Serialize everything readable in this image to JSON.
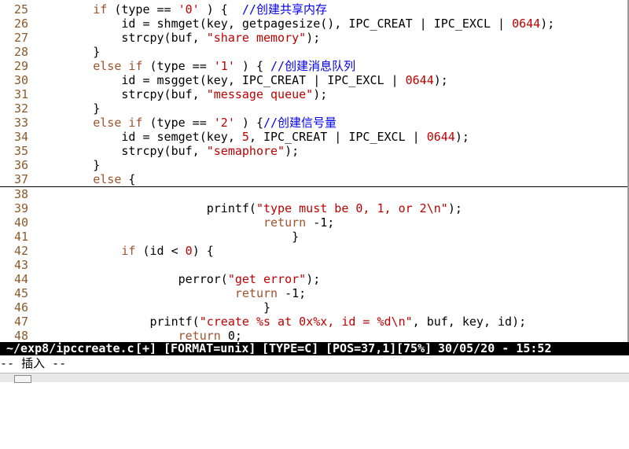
{
  "colors": {
    "keyword": "#a0522d",
    "string": "#c00000",
    "comment": "#0000ee",
    "line_number": "#8b5a2b",
    "status_bg": "#000000",
    "status_fg": "#ffffff"
  },
  "lines": [
    {
      "n": "25",
      "indent": "        ",
      "tokens": [
        [
          "kw",
          "if"
        ],
        [
          "",
          "",
          " "
        ],
        [
          "",
          "("
        ],
        [
          "",
          "type "
        ],
        [
          "",
          "== "
        ],
        [
          "str",
          "'0'"
        ],
        [
          "",
          " )  {  "
        ],
        [
          "cmt",
          "//创建共享内存"
        ]
      ]
    },
    {
      "n": "26",
      "indent": "",
      "tokens": []
    },
    {
      "n": "27",
      "indent": "",
      "tokens": []
    }
  ],
  "code": [
    {
      "n": "25",
      "segs": [
        [
          "",
          "        "
        ],
        [
          "kw",
          "if"
        ],
        [
          "",
          " (type == "
        ],
        [
          "str",
          "'0'"
        ],
        [
          "",
          " ) {  "
        ],
        [
          "cmt",
          "//创建共享内存"
        ]
      ]
    },
    {
      "n": "26",
      "segs": [
        [
          "",
          "            id = shmget(key, getpagesize(), IPC_CREAT | IPC_EXCL | "
        ],
        [
          "num",
          "0644"
        ],
        [
          "",
          ");"
        ]
      ]
    },
    {
      "n": "27",
      "segs": [
        [
          "",
          "            strcpy(buf, "
        ],
        [
          "str",
          "\"share memory\""
        ],
        [
          "",
          ");"
        ]
      ]
    },
    {
      "n": "28",
      "segs": [
        [
          "",
          "        }"
        ]
      ]
    },
    {
      "n": "29",
      "segs": [
        [
          "",
          "        "
        ],
        [
          "kw",
          "else if"
        ],
        [
          "",
          " (type == "
        ],
        [
          "str",
          "'1'"
        ],
        [
          "",
          " ) { "
        ],
        [
          "cmt",
          "//创建消息队列"
        ]
      ]
    },
    {
      "n": "30",
      "segs": [
        [
          "",
          "            id = msgget(key, IPC_CREAT | IPC_EXCL | "
        ],
        [
          "num",
          "0644"
        ],
        [
          "",
          ");"
        ]
      ]
    },
    {
      "n": "31",
      "segs": [
        [
          "",
          "            strcpy(buf, "
        ],
        [
          "str",
          "\"message queue\""
        ],
        [
          "",
          ");"
        ]
      ]
    },
    {
      "n": "32",
      "segs": [
        [
          "",
          "        }"
        ]
      ]
    },
    {
      "n": "33",
      "segs": [
        [
          "",
          "        "
        ],
        [
          "kw",
          "else if"
        ],
        [
          "",
          " (type == "
        ],
        [
          "str",
          "'2'"
        ],
        [
          "",
          " ) {"
        ],
        [
          "cmt",
          "//创建信号量"
        ]
      ]
    },
    {
      "n": "34",
      "segs": [
        [
          "",
          "            id = semget(key, "
        ],
        [
          "num",
          "5"
        ],
        [
          "",
          ", IPC_CREAT | IPC_EXCL | "
        ],
        [
          "num",
          "0644"
        ],
        [
          "",
          ");"
        ]
      ]
    },
    {
      "n": "35",
      "segs": [
        [
          "",
          "            strcpy(buf, "
        ],
        [
          "str",
          "\"semaphore\""
        ],
        [
          "",
          ");"
        ]
      ]
    },
    {
      "n": "36",
      "segs": [
        [
          "",
          "        }"
        ]
      ]
    },
    {
      "n": "37",
      "segs": [
        [
          "",
          "        "
        ],
        [
          "kw",
          "else"
        ],
        [
          "",
          " {"
        ]
      ],
      "cursor": true
    },
    {
      "n": "38",
      "segs": []
    },
    {
      "n": "39",
      "segs": [
        [
          "",
          "                        printf("
        ],
        [
          "str",
          "\"type must be 0, 1, or 2\\n\""
        ],
        [
          "",
          ");"
        ]
      ]
    },
    {
      "n": "40",
      "segs": [
        [
          "",
          "                                "
        ],
        [
          "kw",
          "return"
        ],
        [
          "",
          " -1;"
        ]
      ]
    },
    {
      "n": "41",
      "segs": [
        [
          "",
          "                                    }"
        ]
      ]
    },
    {
      "n": "42",
      "segs": [
        [
          "",
          "            "
        ],
        [
          "kw",
          "if"
        ],
        [
          "",
          " (id < "
        ],
        [
          "num",
          "0"
        ],
        [
          "",
          ") {"
        ]
      ]
    },
    {
      "n": "43",
      "segs": []
    },
    {
      "n": "44",
      "segs": [
        [
          "",
          "                    perror("
        ],
        [
          "str",
          "\"get error\""
        ],
        [
          "",
          ");"
        ]
      ]
    },
    {
      "n": "45",
      "segs": [
        [
          "",
          "                            "
        ],
        [
          "kw",
          "return"
        ],
        [
          "",
          " -1;"
        ]
      ]
    },
    {
      "n": "46",
      "segs": [
        [
          "",
          "                                }"
        ]
      ]
    },
    {
      "n": "47",
      "segs": [
        [
          "",
          "                printf("
        ],
        [
          "str",
          "\"create %s at 0x%x, id = %d\\n\""
        ],
        [
          "",
          ", buf, key, id);"
        ]
      ]
    },
    {
      "n": "48",
      "segs": [
        [
          "",
          "                    "
        ],
        [
          "kw",
          "return"
        ],
        [
          "",
          " 0;"
        ]
      ]
    }
  ],
  "status": {
    "file": "~/exp8/ipccreate.c",
    "flag": "[+]",
    "format": "[FORMAT=unix]",
    "type": "[TYPE=C]",
    "pos": "[POS=37,1]",
    "percent": "[75%]",
    "datetime": "30/05/20 - 15:52"
  },
  "mode": "-- 插入 --"
}
